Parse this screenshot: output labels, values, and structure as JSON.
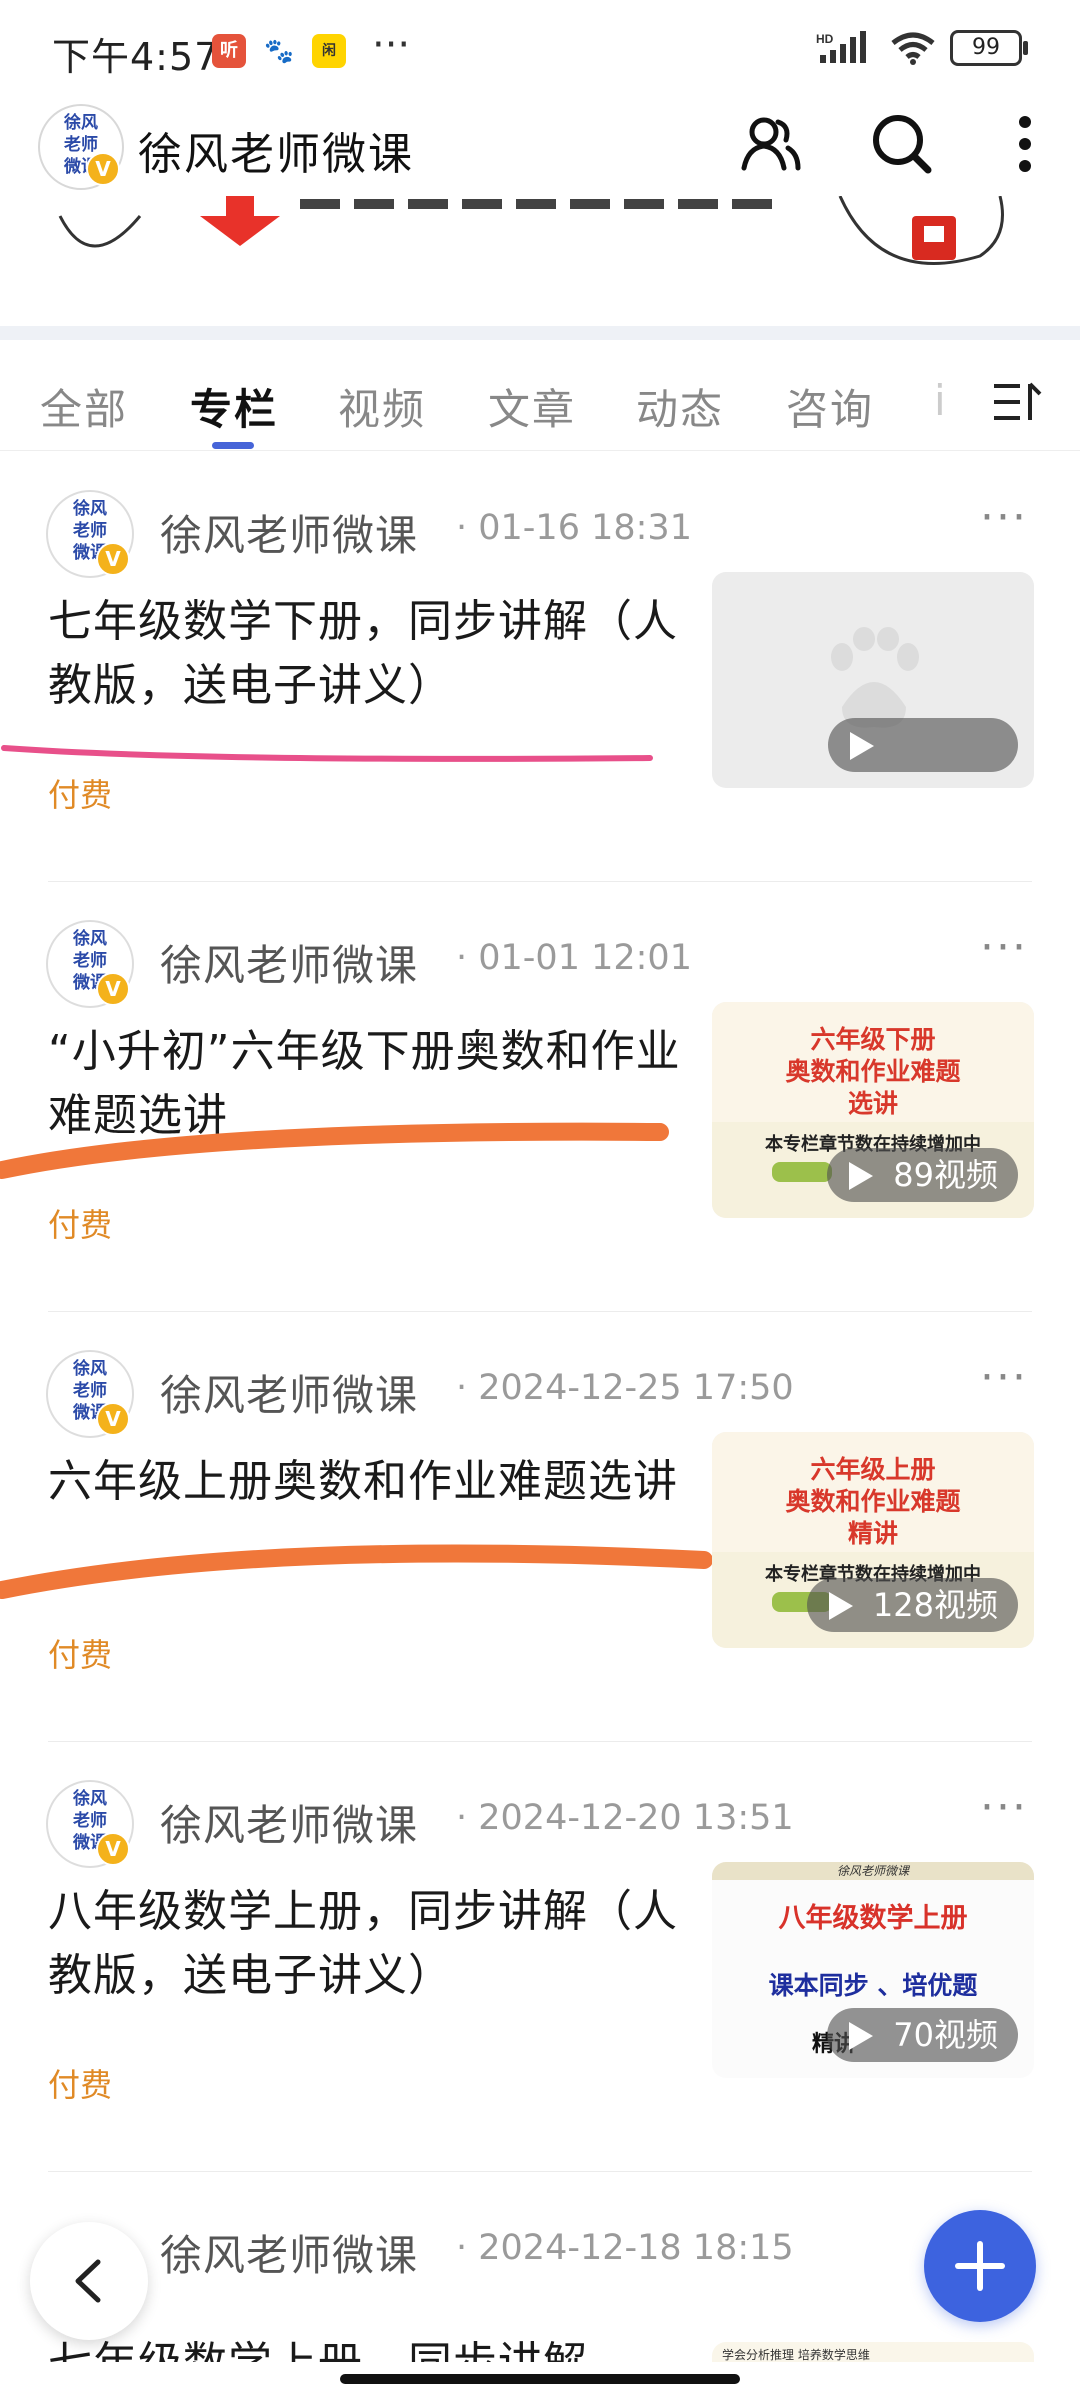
{
  "status_bar": {
    "time": "下午4:57",
    "apps": [
      "听",
      "百度",
      "闲鱼"
    ],
    "more": "···",
    "network": "HD",
    "battery": "99"
  },
  "header": {
    "logo_text": "徐风老师微课",
    "title": "徐风老师微课",
    "icons": [
      "users-icon",
      "search-icon",
      "more-vertical-icon"
    ]
  },
  "tabs": {
    "items": [
      "全部",
      "专栏",
      "视频",
      "文章",
      "动态",
      "咨询",
      "i",
      "三"
    ],
    "active_index": 1
  },
  "feed": [
    {
      "author": "徐风老师微课",
      "date": "01-16 18:31",
      "title": "七年级数学下册，同步讲解（人教版，送电子讲义）",
      "tag": "付费",
      "thumb_type": "placeholder",
      "video_count": "",
      "highlight_color": "#e8508a"
    },
    {
      "author": "徐风老师微课",
      "date": "01-01 12:01",
      "title": "“小升初”六年级下册奥数和作业难题选讲",
      "tag": "付费",
      "thumb_type": "banner",
      "thumb_lines": [
        "六年级下册",
        "奥数和作业难题",
        "选讲"
      ],
      "thumb_note": "本专栏章节数在持续增加中",
      "video_count": "89视频",
      "highlight_color": "#f0773a"
    },
    {
      "author": "徐风老师微课",
      "date": "2024-12-25 17:50",
      "title": "六年级上册奥数和作业难题选讲",
      "tag": "付费",
      "thumb_type": "banner",
      "thumb_lines": [
        "六年级上册",
        "奥数和作业难题",
        "精讲"
      ],
      "thumb_note": "本专栏章节数在持续增加中",
      "video_count": "128视频",
      "highlight_color": "#f0773a"
    },
    {
      "author": "徐风老师微课",
      "date": "2024-12-20 13:51",
      "title": "八年级数学上册，同步讲解（人教版，送电子讲义）",
      "tag": "付费",
      "thumb_type": "banner2",
      "thumb_head": "徐风老师微课",
      "thumb_lines": [
        "八年级数学上册",
        "课本同步 、培优题",
        "精讲"
      ],
      "video_count": "70视频",
      "highlight_color": ""
    },
    {
      "author": "徐风老师微课",
      "date": "2024-12-18 18:15",
      "title": "七年级数学上册，同步讲解",
      "tag": "",
      "thumb_type": "banner3",
      "thumb_head": "学会分析推理 培养数学思维",
      "video_count": "",
      "highlight_color": ""
    }
  ],
  "colors": {
    "accent": "#4664d8",
    "paid": "#e08a26",
    "fab": "#3d63df",
    "badge": "#f4b21b"
  }
}
